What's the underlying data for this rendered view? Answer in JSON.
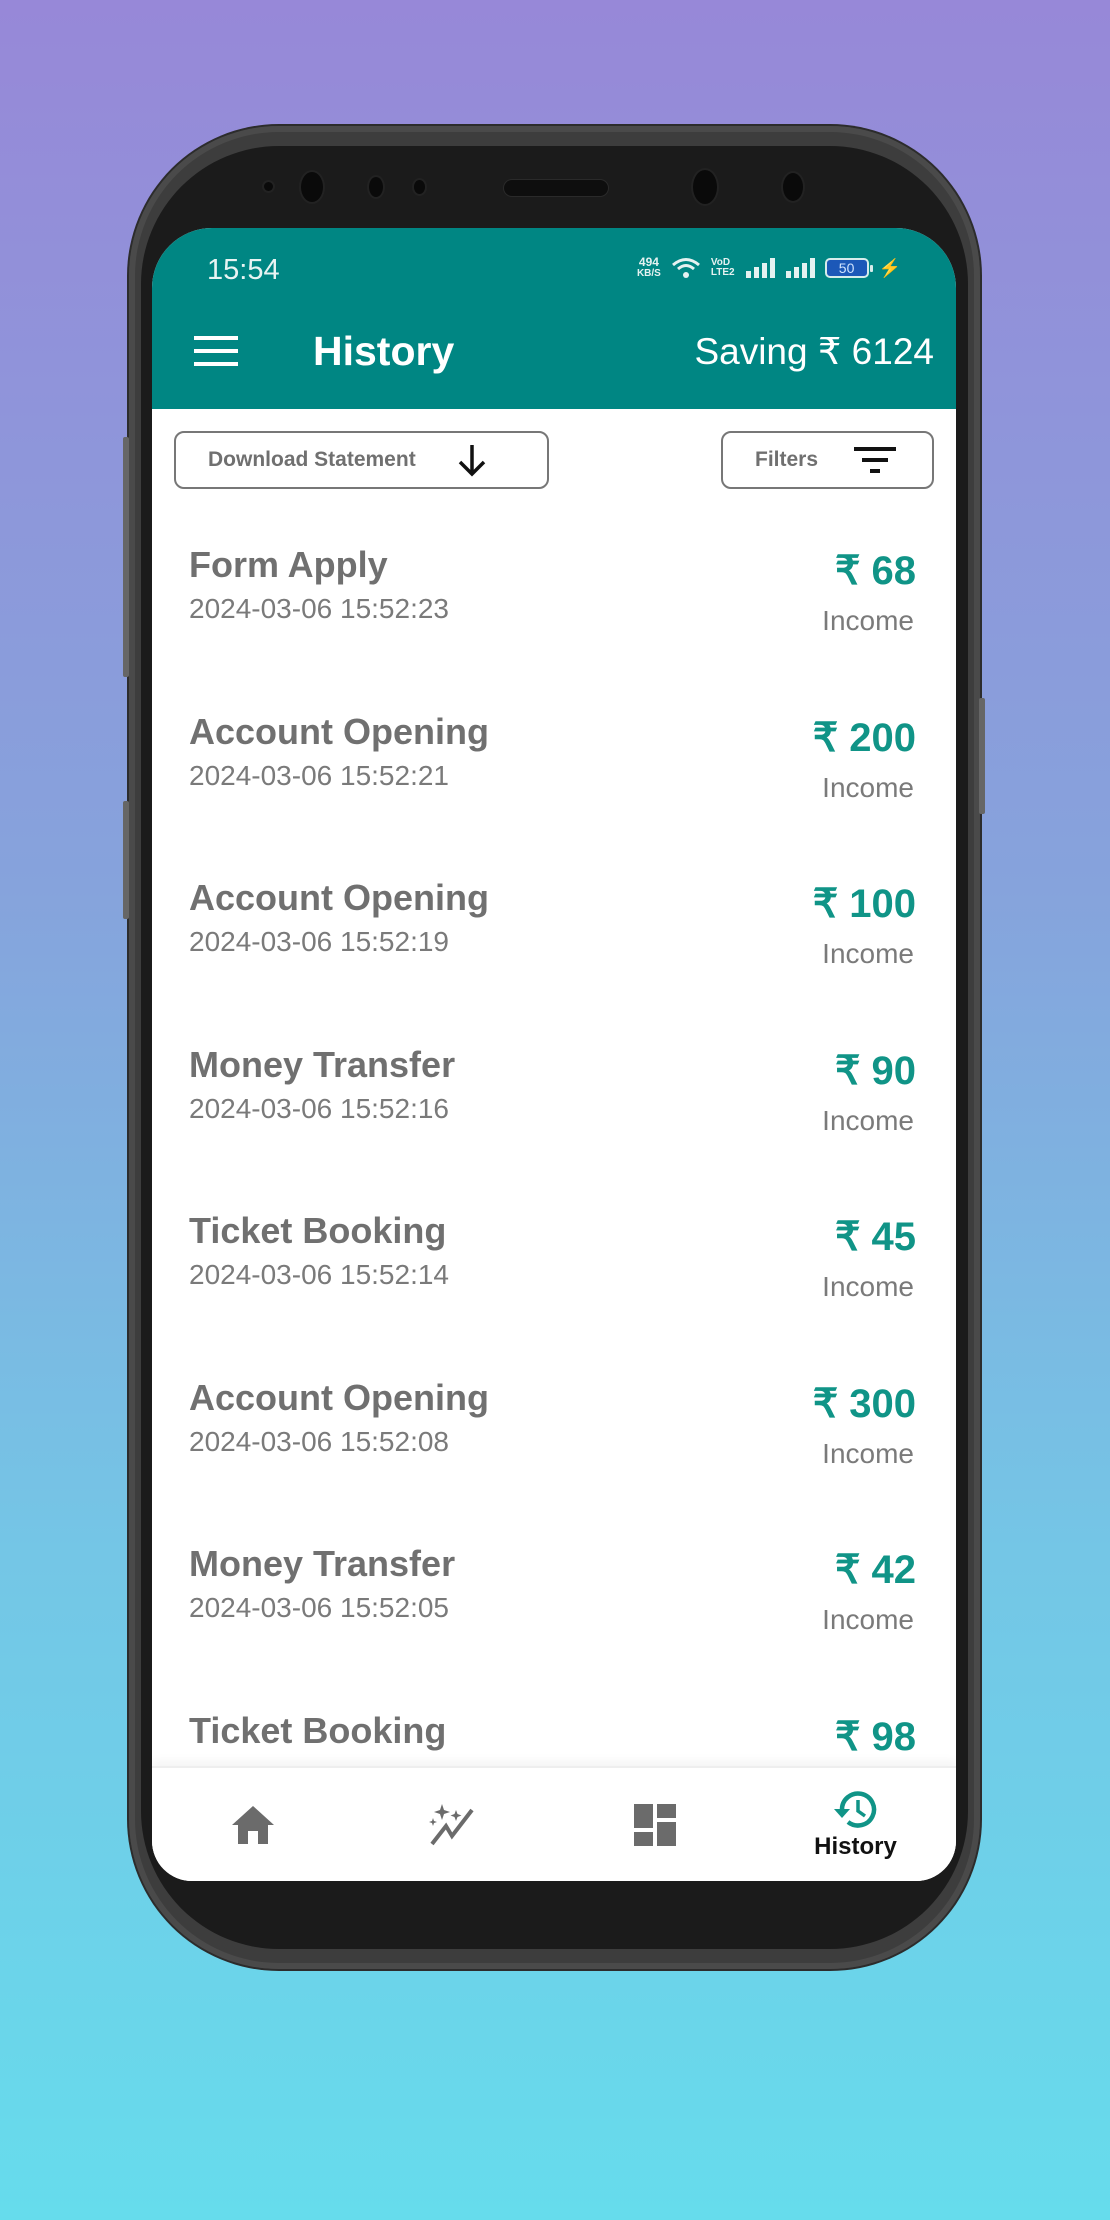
{
  "status_bar": {
    "time": "15:54",
    "net_speed_value": "494",
    "net_speed_unit": "KB/S",
    "volte_label": "VoLTE",
    "battery_level": "50"
  },
  "app_bar": {
    "title": "History",
    "saving_label": "Saving ₹ 6124",
    "menu_icon": "hamburger-menu-icon",
    "color": "#008683"
  },
  "actions": {
    "download_label": "Download Statement",
    "download_icon": "arrow-down-icon",
    "filters_label": "Filters",
    "filters_icon": "filter-list-icon"
  },
  "transactions": [
    {
      "title": "Form Apply",
      "timestamp": "2024-03-06 15:52:23",
      "amount": "₹ 68",
      "type": "Income"
    },
    {
      "title": "Account Opening",
      "timestamp": "2024-03-06 15:52:21",
      "amount": "₹ 200",
      "type": "Income"
    },
    {
      "title": "Account Opening",
      "timestamp": "2024-03-06 15:52:19",
      "amount": "₹ 100",
      "type": "Income"
    },
    {
      "title": "Money Transfer",
      "timestamp": "2024-03-06 15:52:16",
      "amount": "₹ 90",
      "type": "Income"
    },
    {
      "title": "Ticket Booking",
      "timestamp": "2024-03-06 15:52:14",
      "amount": "₹ 45",
      "type": "Income"
    },
    {
      "title": "Account Opening",
      "timestamp": "2024-03-06 15:52:08",
      "amount": "₹ 300",
      "type": "Income"
    },
    {
      "title": "Money Transfer",
      "timestamp": "2024-03-06 15:52:05",
      "amount": "₹ 42",
      "type": "Income"
    },
    {
      "title": "Ticket Booking",
      "timestamp": "",
      "amount": "₹ 98",
      "type": ""
    }
  ],
  "bottom_nav": {
    "items": [
      {
        "icon": "home-icon",
        "label": "",
        "active": false
      },
      {
        "icon": "sparkle-trend-icon",
        "label": "",
        "active": false
      },
      {
        "icon": "dashboard-icon",
        "label": "",
        "active": false
      },
      {
        "icon": "history-icon",
        "label": "History",
        "active": true
      }
    ]
  },
  "colors": {
    "accent": "#008683",
    "amount": "#109487",
    "text_muted": "#707070"
  }
}
